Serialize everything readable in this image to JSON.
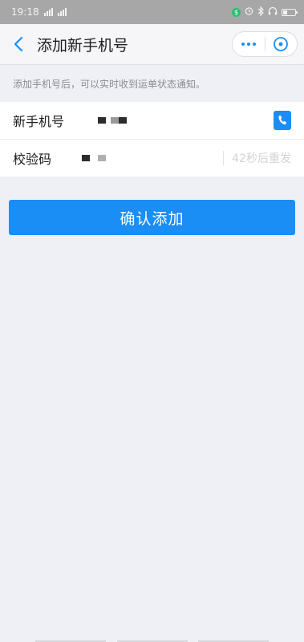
{
  "status_bar": {
    "time": "19:18",
    "colors": {
      "bg": "#a7a7a7",
      "badge": "#2fbf71"
    },
    "icons": [
      "signal-icon",
      "signal-icon",
      "badge-icon",
      "alarm-icon",
      "bluetooth-icon",
      "headphones-icon",
      "battery-icon"
    ]
  },
  "nav": {
    "title": "添加新手机号",
    "back_icon": "chevron-left-icon",
    "more_icon": "more-dots-icon",
    "close_icon": "close-circle-icon"
  },
  "hint": "添加手机号后，可以实时收到运单状态通知。",
  "form": {
    "phone": {
      "label": "新手机号",
      "contact_icon": "contacts-phone-icon"
    },
    "code": {
      "label": "校验码",
      "resend": "42秒后重发"
    }
  },
  "confirm_button": "确认添加",
  "colors": {
    "accent": "#1a8ef5",
    "page_bg": "#eff0f5",
    "hint_text": "#8a8a90"
  }
}
